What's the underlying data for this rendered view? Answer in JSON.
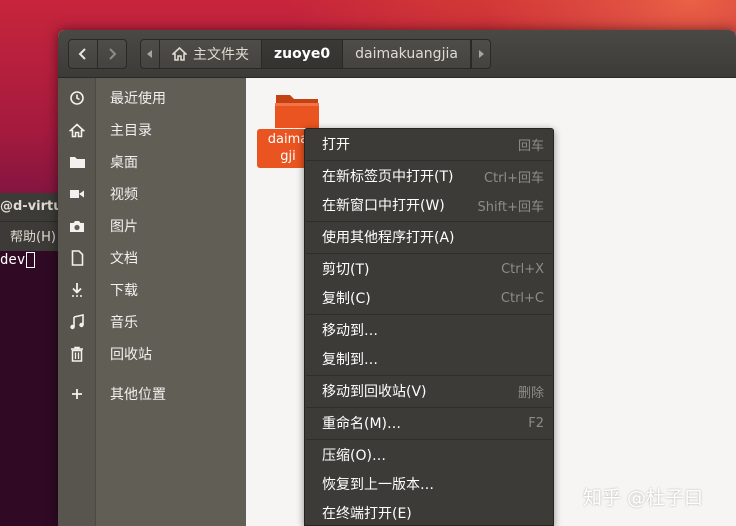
{
  "terminal": {
    "title": "@d-virtu",
    "menu_item": "帮助(H)",
    "prompt_line": "dev"
  },
  "header": {
    "breadcrumbs": [
      "主文件夹",
      "zuoye0",
      "daimakuangjia"
    ]
  },
  "sidebar": {
    "items": [
      {
        "label": "最近使用",
        "icon": "recent-icon"
      },
      {
        "label": "主目录",
        "icon": "home-icon"
      },
      {
        "label": "桌面",
        "icon": "folder-icon"
      },
      {
        "label": "视频",
        "icon": "video-icon"
      },
      {
        "label": "图片",
        "icon": "camera-icon"
      },
      {
        "label": "文档",
        "icon": "document-icon"
      },
      {
        "label": "下载",
        "icon": "download-icon"
      },
      {
        "label": "音乐",
        "icon": "music-icon"
      },
      {
        "label": "回收站",
        "icon": "trash-icon"
      },
      {
        "label": "其他位置",
        "icon": "plus-icon"
      }
    ]
  },
  "content": {
    "folder_label_line1": "daima",
    "folder_label_line2": "gji"
  },
  "context_menu": {
    "items": [
      {
        "label": "打开",
        "accel": "回车"
      },
      {
        "label": "在新标签页中打开(T)",
        "accel": "Ctrl+回车"
      },
      {
        "label": "在新窗口中打开(W)",
        "accel": "Shift+回车"
      },
      {
        "label": "使用其他程序打开(A)",
        "accel": ""
      },
      {
        "label": "剪切(T)",
        "accel": "Ctrl+X"
      },
      {
        "label": "复制(C)",
        "accel": "Ctrl+C"
      },
      {
        "label": "移动到…",
        "accel": ""
      },
      {
        "label": "复制到…",
        "accel": ""
      },
      {
        "label": "移动到回收站(V)",
        "accel": "删除"
      },
      {
        "label": "重命名(M)…",
        "accel": "F2"
      },
      {
        "label": "压缩(O)…",
        "accel": ""
      },
      {
        "label": "恢复到上一版本…",
        "accel": ""
      },
      {
        "label": "在终端打开(E)",
        "accel": ""
      }
    ]
  },
  "watermark": "知乎 @杜子曰",
  "colors": {
    "accent": "#e95420",
    "sidebar": "#605e55",
    "menu_bg": "#3c3b37"
  }
}
